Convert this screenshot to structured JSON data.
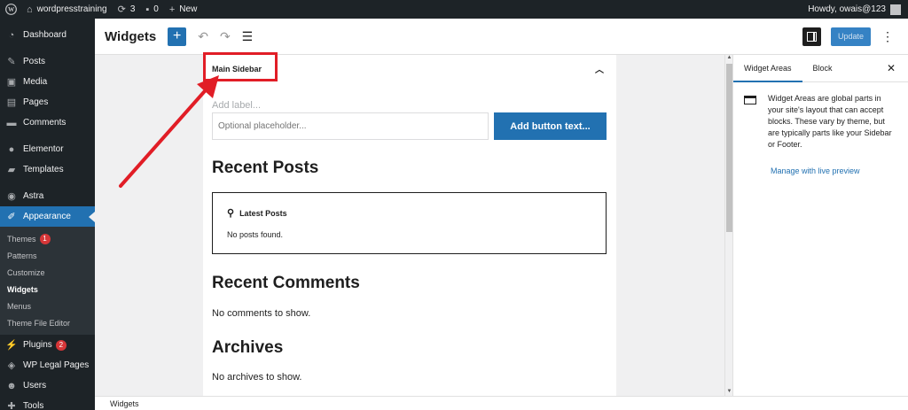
{
  "adminbar": {
    "site_name": "wordpresstraining",
    "updates_count": "3",
    "comments_count": "0",
    "new_label": "New",
    "howdy": "Howdy, owais@123"
  },
  "menu": {
    "dashboard": "Dashboard",
    "posts": "Posts",
    "media": "Media",
    "pages": "Pages",
    "comments": "Comments",
    "elementor": "Elementor",
    "templates": "Templates",
    "astra": "Astra",
    "appearance": "Appearance",
    "sub": {
      "themes": "Themes",
      "themes_badge": "1",
      "patterns": "Patterns",
      "customize": "Customize",
      "widgets": "Widgets",
      "menus": "Menus",
      "theme_file_editor": "Theme File Editor"
    },
    "plugins": "Plugins",
    "plugins_badge": "2",
    "wp_legal_pages": "WP Legal Pages",
    "users": "Users",
    "tools": "Tools"
  },
  "header": {
    "title": "Widgets",
    "update_label": "Update"
  },
  "widget_area": {
    "title": "Main Sidebar",
    "add_label_placeholder": "Add label...",
    "search_placeholder": "Optional placeholder...",
    "search_button": "Add button text...",
    "recent_posts_heading": "Recent Posts",
    "latest_posts_title": "Latest Posts",
    "no_posts": "No posts found.",
    "recent_comments_heading": "Recent Comments",
    "no_comments": "No comments to show.",
    "archives_heading": "Archives",
    "no_archives": "No archives to show."
  },
  "sidebar": {
    "tab_widget_areas": "Widget Areas",
    "tab_block": "Block",
    "description": "Widget Areas are global parts in your site's layout that can accept blocks. These vary by theme, but are typically parts like your Sidebar or Footer.",
    "manage_link": "Manage with live preview"
  },
  "footer": {
    "breadcrumb": "Widgets"
  },
  "colors": {
    "accent": "#2271b1",
    "annotation": "#e11d26",
    "admin_dark": "#1d2327"
  }
}
